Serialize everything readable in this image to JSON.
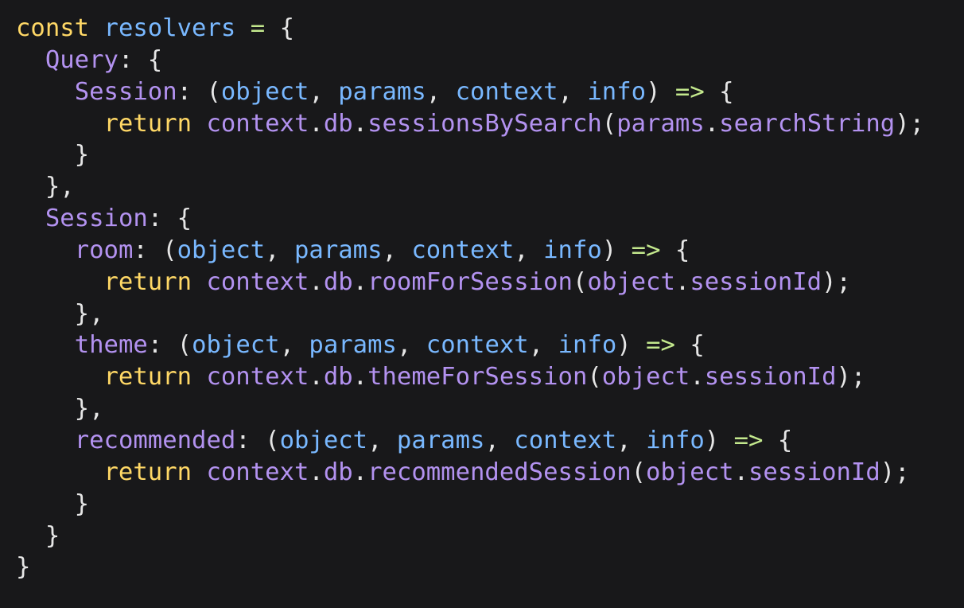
{
  "editor": {
    "colors": {
      "background": "#18181a",
      "kw": "#ffd866",
      "def": "#79b8ff",
      "punc": "#e6e6e6",
      "op": "#c3e88d",
      "prop": "#b392f0",
      "param": "#79b8ff",
      "ident": "#b392f0",
      "method": "#b392f0"
    },
    "lines": [
      {
        "tokens": [
          {
            "t": "const",
            "k": "kw"
          },
          {
            "t": " ",
            "k": "punc"
          },
          {
            "t": "resolvers",
            "k": "def"
          },
          {
            "t": " ",
            "k": "punc"
          },
          {
            "t": "=",
            "k": "op"
          },
          {
            "t": " {",
            "k": "punc"
          }
        ]
      },
      {
        "tokens": [
          {
            "t": "  ",
            "k": "punc"
          },
          {
            "t": "Query",
            "k": "prop"
          },
          {
            "t": ": {",
            "k": "punc"
          }
        ]
      },
      {
        "tokens": [
          {
            "t": "    ",
            "k": "punc"
          },
          {
            "t": "Session",
            "k": "prop"
          },
          {
            "t": ": (",
            "k": "punc"
          },
          {
            "t": "object",
            "k": "param"
          },
          {
            "t": ", ",
            "k": "punc"
          },
          {
            "t": "params",
            "k": "param"
          },
          {
            "t": ", ",
            "k": "punc"
          },
          {
            "t": "context",
            "k": "param"
          },
          {
            "t": ", ",
            "k": "punc"
          },
          {
            "t": "info",
            "k": "param"
          },
          {
            "t": ") ",
            "k": "punc"
          },
          {
            "t": "=>",
            "k": "op"
          },
          {
            "t": " {",
            "k": "punc"
          }
        ]
      },
      {
        "tokens": [
          {
            "t": "      ",
            "k": "punc"
          },
          {
            "t": "return",
            "k": "kw"
          },
          {
            "t": " ",
            "k": "punc"
          },
          {
            "t": "context",
            "k": "ident"
          },
          {
            "t": ".",
            "k": "punc"
          },
          {
            "t": "db",
            "k": "ident"
          },
          {
            "t": ".",
            "k": "punc"
          },
          {
            "t": "sessionsBySearch",
            "k": "method"
          },
          {
            "t": "(",
            "k": "punc"
          },
          {
            "t": "params",
            "k": "ident"
          },
          {
            "t": ".",
            "k": "punc"
          },
          {
            "t": "searchString",
            "k": "ident"
          },
          {
            "t": ");",
            "k": "punc"
          }
        ]
      },
      {
        "tokens": [
          {
            "t": "    }",
            "k": "punc"
          }
        ]
      },
      {
        "tokens": [
          {
            "t": "  },",
            "k": "punc"
          }
        ]
      },
      {
        "tokens": [
          {
            "t": "  ",
            "k": "punc"
          },
          {
            "t": "Session",
            "k": "prop"
          },
          {
            "t": ": {",
            "k": "punc"
          }
        ]
      },
      {
        "tokens": [
          {
            "t": "    ",
            "k": "punc"
          },
          {
            "t": "room",
            "k": "prop"
          },
          {
            "t": ": (",
            "k": "punc"
          },
          {
            "t": "object",
            "k": "param"
          },
          {
            "t": ", ",
            "k": "punc"
          },
          {
            "t": "params",
            "k": "param"
          },
          {
            "t": ", ",
            "k": "punc"
          },
          {
            "t": "context",
            "k": "param"
          },
          {
            "t": ", ",
            "k": "punc"
          },
          {
            "t": "info",
            "k": "param"
          },
          {
            "t": ") ",
            "k": "punc"
          },
          {
            "t": "=>",
            "k": "op"
          },
          {
            "t": " {",
            "k": "punc"
          }
        ]
      },
      {
        "tokens": [
          {
            "t": "      ",
            "k": "punc"
          },
          {
            "t": "return",
            "k": "kw"
          },
          {
            "t": " ",
            "k": "punc"
          },
          {
            "t": "context",
            "k": "ident"
          },
          {
            "t": ".",
            "k": "punc"
          },
          {
            "t": "db",
            "k": "ident"
          },
          {
            "t": ".",
            "k": "punc"
          },
          {
            "t": "roomForSession",
            "k": "method"
          },
          {
            "t": "(",
            "k": "punc"
          },
          {
            "t": "object",
            "k": "ident"
          },
          {
            "t": ".",
            "k": "punc"
          },
          {
            "t": "sessionId",
            "k": "ident"
          },
          {
            "t": ");",
            "k": "punc"
          }
        ]
      },
      {
        "tokens": [
          {
            "t": "    },",
            "k": "punc"
          }
        ]
      },
      {
        "tokens": [
          {
            "t": "    ",
            "k": "punc"
          },
          {
            "t": "theme",
            "k": "prop"
          },
          {
            "t": ": (",
            "k": "punc"
          },
          {
            "t": "object",
            "k": "param"
          },
          {
            "t": ", ",
            "k": "punc"
          },
          {
            "t": "params",
            "k": "param"
          },
          {
            "t": ", ",
            "k": "punc"
          },
          {
            "t": "context",
            "k": "param"
          },
          {
            "t": ", ",
            "k": "punc"
          },
          {
            "t": "info",
            "k": "param"
          },
          {
            "t": ") ",
            "k": "punc"
          },
          {
            "t": "=>",
            "k": "op"
          },
          {
            "t": " {",
            "k": "punc"
          }
        ]
      },
      {
        "tokens": [
          {
            "t": "      ",
            "k": "punc"
          },
          {
            "t": "return",
            "k": "kw"
          },
          {
            "t": " ",
            "k": "punc"
          },
          {
            "t": "context",
            "k": "ident"
          },
          {
            "t": ".",
            "k": "punc"
          },
          {
            "t": "db",
            "k": "ident"
          },
          {
            "t": ".",
            "k": "punc"
          },
          {
            "t": "themeForSession",
            "k": "method"
          },
          {
            "t": "(",
            "k": "punc"
          },
          {
            "t": "object",
            "k": "ident"
          },
          {
            "t": ".",
            "k": "punc"
          },
          {
            "t": "sessionId",
            "k": "ident"
          },
          {
            "t": ");",
            "k": "punc"
          }
        ]
      },
      {
        "tokens": [
          {
            "t": "    },",
            "k": "punc"
          }
        ]
      },
      {
        "tokens": [
          {
            "t": "    ",
            "k": "punc"
          },
          {
            "t": "recommended",
            "k": "prop"
          },
          {
            "t": ": (",
            "k": "punc"
          },
          {
            "t": "object",
            "k": "param"
          },
          {
            "t": ", ",
            "k": "punc"
          },
          {
            "t": "params",
            "k": "param"
          },
          {
            "t": ", ",
            "k": "punc"
          },
          {
            "t": "context",
            "k": "param"
          },
          {
            "t": ", ",
            "k": "punc"
          },
          {
            "t": "info",
            "k": "param"
          },
          {
            "t": ") ",
            "k": "punc"
          },
          {
            "t": "=>",
            "k": "op"
          },
          {
            "t": " {",
            "k": "punc"
          }
        ]
      },
      {
        "tokens": [
          {
            "t": "      ",
            "k": "punc"
          },
          {
            "t": "return",
            "k": "kw"
          },
          {
            "t": " ",
            "k": "punc"
          },
          {
            "t": "context",
            "k": "ident"
          },
          {
            "t": ".",
            "k": "punc"
          },
          {
            "t": "db",
            "k": "ident"
          },
          {
            "t": ".",
            "k": "punc"
          },
          {
            "t": "recommendedSession",
            "k": "method"
          },
          {
            "t": "(",
            "k": "punc"
          },
          {
            "t": "object",
            "k": "ident"
          },
          {
            "t": ".",
            "k": "punc"
          },
          {
            "t": "sessionId",
            "k": "ident"
          },
          {
            "t": ");",
            "k": "punc"
          }
        ]
      },
      {
        "tokens": [
          {
            "t": "    }",
            "k": "punc"
          }
        ]
      },
      {
        "tokens": [
          {
            "t": "  }",
            "k": "punc"
          }
        ]
      },
      {
        "tokens": [
          {
            "t": "}",
            "k": "punc"
          }
        ]
      }
    ]
  }
}
